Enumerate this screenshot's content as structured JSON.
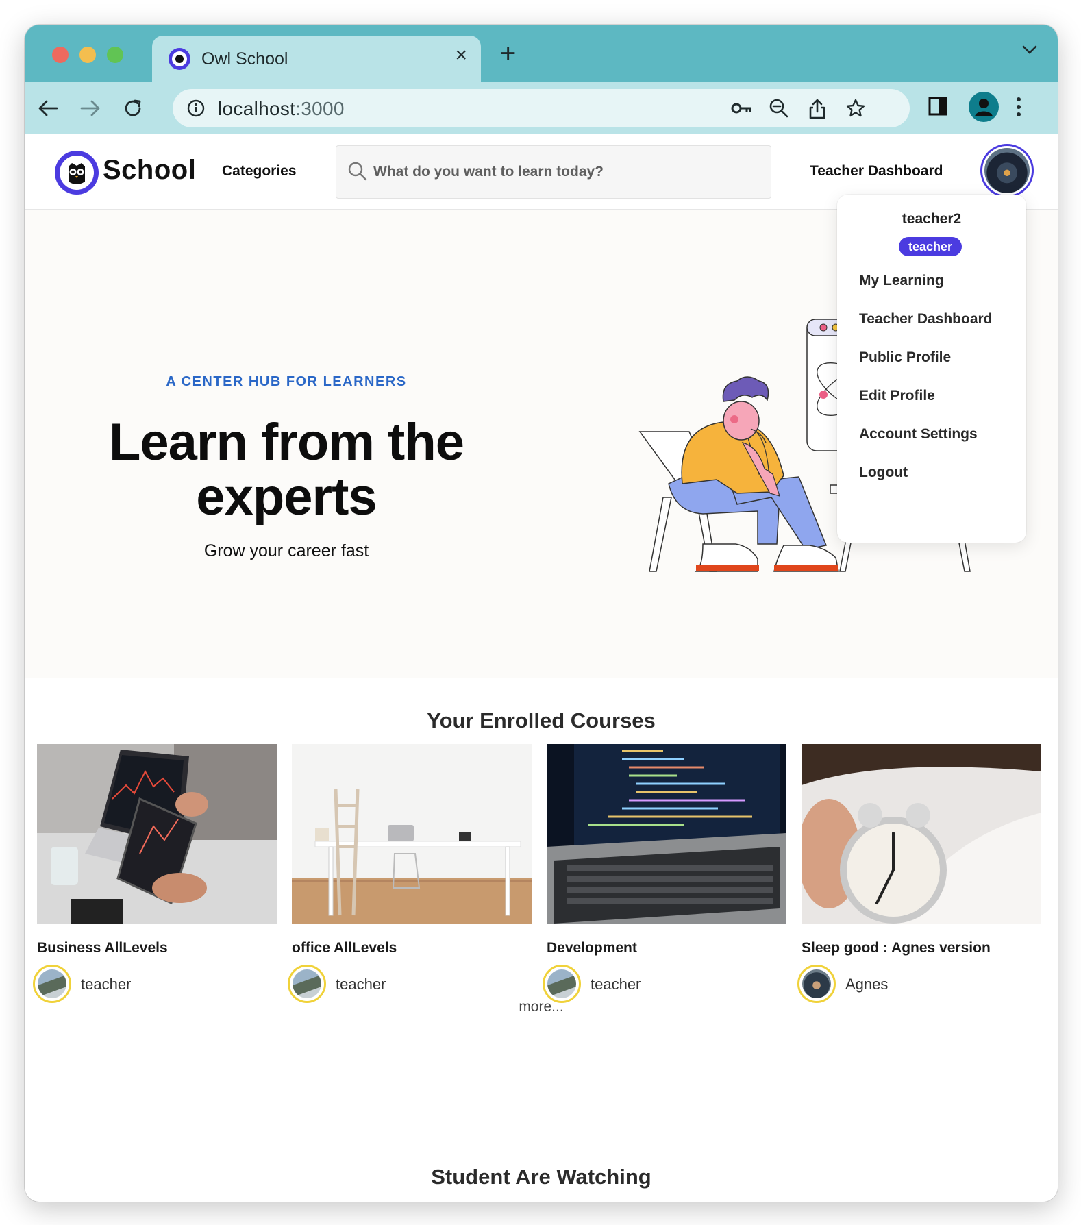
{
  "browser": {
    "tab_title": "Owl School",
    "url_host": "localhost",
    "url_port": ":3000"
  },
  "header": {
    "logo_text": "School",
    "categories": "Categories",
    "search_placeholder": "What do you want to learn today?",
    "teacher_dashboard": "Teacher Dashboard"
  },
  "hero": {
    "eyebrow": "A CENTER HUB FOR LEARNERS",
    "title": "Learn from the experts",
    "subtitle": "Grow your career fast"
  },
  "dropdown": {
    "username": "teacher2",
    "role": "teacher",
    "items": [
      "My Learning",
      "Teacher Dashboard",
      "Public Profile",
      "Edit Profile",
      "Account Settings",
      "Logout"
    ]
  },
  "enrolled": {
    "title": "Your Enrolled Courses",
    "courses": [
      {
        "name": "Business AllLevels",
        "author": "teacher"
      },
      {
        "name": "office AllLevels",
        "author": "teacher"
      },
      {
        "name": "Development",
        "author": "teacher"
      },
      {
        "name": "Sleep good : Agnes version",
        "author": "Agnes"
      }
    ],
    "more": "more..."
  },
  "watching": {
    "title": "Student Are Watching"
  },
  "colors": {
    "brand": "#4b3be0",
    "chrome_tab": "#5db8c2",
    "eyebrow": "#2a67c7",
    "avatar_ring": "#f0d23a"
  }
}
